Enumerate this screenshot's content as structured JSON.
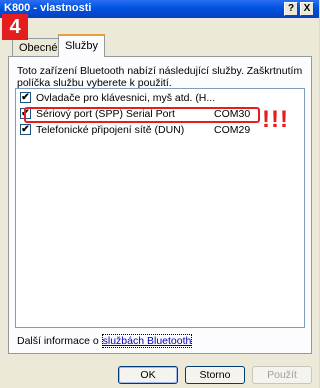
{
  "window": {
    "title": "K800 - vlastnosti",
    "help_button": "?",
    "close_button": "X"
  },
  "annotation": {
    "step_number": "4",
    "alert": "!!!",
    "color": "#e41e1e"
  },
  "tabs": [
    {
      "label": "Obecné",
      "active": false
    },
    {
      "label": "Služby",
      "active": true
    }
  ],
  "panel": {
    "description": "Toto zařízení Bluetooth nabízí následující služby. Zaškrtnutím políčka službu vyberete k použití.",
    "services": [
      {
        "name": "Ovladače pro klávesnici, myš atd. (H...",
        "port": "",
        "checked": true
      },
      {
        "name": "Sériový port (SPP) Serial Port",
        "port": "COM30",
        "checked": true
      },
      {
        "name": "Telefonické připojení sítě (DUN)",
        "port": "COM29",
        "checked": true
      }
    ],
    "more_info_prefix": "Další informace o ",
    "more_info_link": "službách Bluetooth"
  },
  "buttons": {
    "ok": "OK",
    "cancel": "Storno",
    "apply": "Použít"
  }
}
